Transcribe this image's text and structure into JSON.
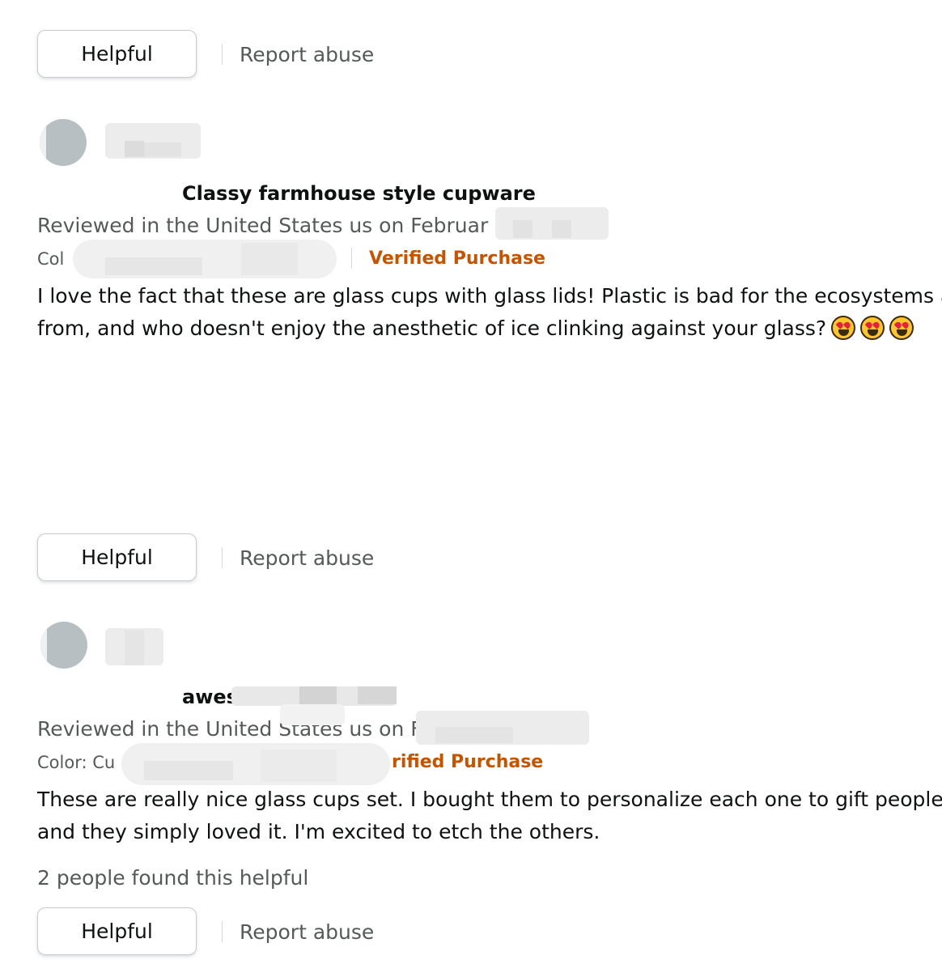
{
  "actions": {
    "helpful_label": "Helpful",
    "report_label": "Report abuse"
  },
  "reviews": [
    {
      "title": "Classy farmhouse style cupware",
      "date_text": "Reviewed in the United States us on Februar",
      "color_text": "Col",
      "verified_text": "Verified Purchase",
      "body_line1": "I love the fact that these are glass cups with glass lids! Plastic is bad for the ecosystems a",
      "body_line2": "from, and who doesn't enjoy the anesthetic of ice clinking against your glass?",
      "emoji": "heart-eyes-emoji"
    },
    {
      "title": "awes",
      "date_text": "Reviewed in the United States us on F",
      "color_text": "Color: Cu",
      "verified_text": "rified Purchase",
      "body_line1": "These are really nice glass cups set. I bought them to personalize each one to gift people",
      "body_line2": "and they simply loved it. I'm excited to etch the others.",
      "helpful_count": "2 people found this helpful"
    }
  ],
  "colors": {
    "verified": "#c45500",
    "secondary_text": "#565959"
  }
}
